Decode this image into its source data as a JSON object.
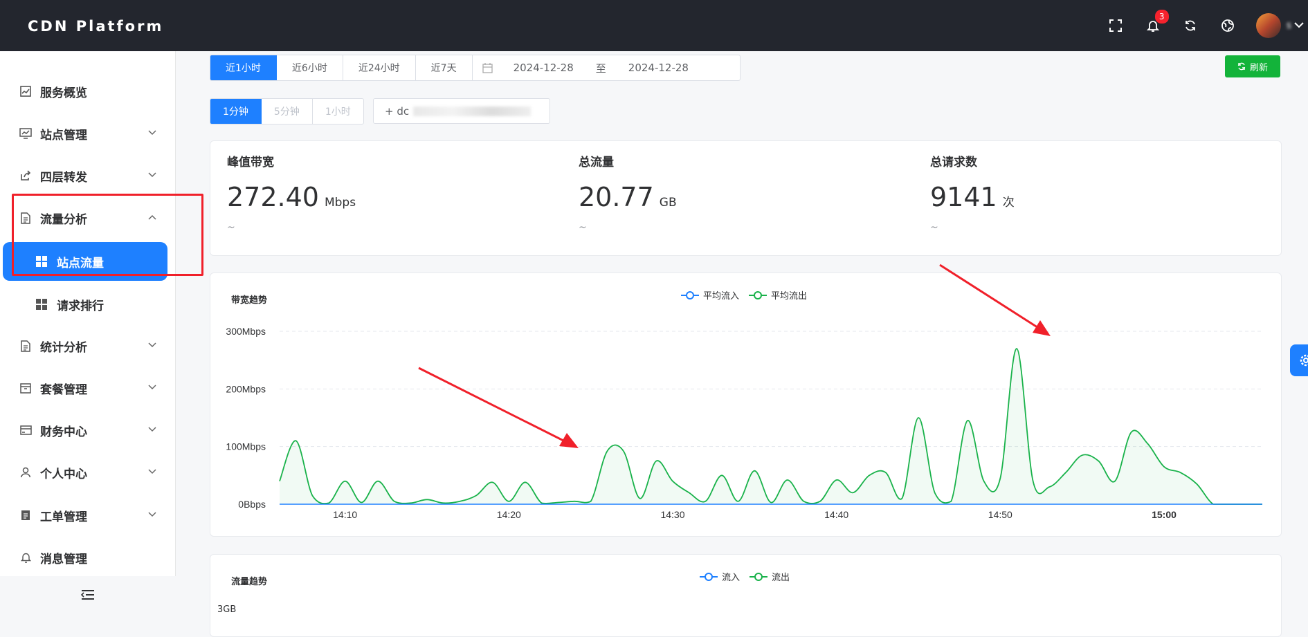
{
  "app": {
    "title": "CDN Platform"
  },
  "topbar": {
    "notification_count": "3",
    "username": "s"
  },
  "sidebar": {
    "items": [
      {
        "label": "服务概览",
        "icon": "chart-icon"
      },
      {
        "label": "站点管理",
        "icon": "monitor-icon"
      },
      {
        "label": "四层转发",
        "icon": "share-icon"
      },
      {
        "label": "流量分析",
        "icon": "document-icon"
      },
      {
        "label": "统计分析",
        "icon": "document-icon"
      },
      {
        "label": "套餐管理",
        "icon": "box-icon"
      },
      {
        "label": "财务中心",
        "icon": "card-icon"
      },
      {
        "label": "个人中心",
        "icon": "user-icon"
      },
      {
        "label": "工单管理",
        "icon": "ticket-icon"
      },
      {
        "label": "消息管理",
        "icon": "bell-icon"
      }
    ],
    "submenu": [
      {
        "label": "站点流量",
        "active": true
      },
      {
        "label": "请求排行",
        "active": false
      }
    ]
  },
  "filters": {
    "time_ranges": [
      "近1小时",
      "近6小时",
      "近24小时",
      "近7天"
    ],
    "date_start": "2024-12-28",
    "date_sep": "至",
    "date_end": "2024-12-28",
    "granularity": [
      "1分钟",
      "5分钟",
      "1小时"
    ],
    "domain_prefix": "+ dc",
    "refresh_label": "刷新"
  },
  "stats": [
    {
      "label": "峰值带宽",
      "value": "272.40",
      "unit": "Mbps",
      "sub": "~"
    },
    {
      "label": "总流量",
      "value": "20.77",
      "unit": "GB",
      "sub": "~"
    },
    {
      "label": "总请求数",
      "value": "9141",
      "unit": "次",
      "sub": "~"
    }
  ],
  "bandwidth_chart": {
    "title": "带宽趋势",
    "legend": [
      "平均流入",
      "平均流出"
    ]
  },
  "traffic_chart": {
    "title": "流量趋势",
    "legend": [
      "流入",
      "流出"
    ],
    "first_tick": "3GB"
  },
  "colors": {
    "primary": "#1e80ff",
    "success": "#13b33a",
    "inflow": "#1e80ff",
    "outflow": "#19b24a"
  },
  "chart_data": {
    "type": "line",
    "title": "带宽趋势",
    "xlabel": "",
    "ylabel": "",
    "y_ticks": [
      "0Bbps",
      "100Mbps",
      "200Mbps",
      "300Mbps"
    ],
    "ylim": [
      0,
      300
    ],
    "x_ticks": [
      "14:10",
      "14:20",
      "14:30",
      "14:40",
      "14:50",
      "15:00"
    ],
    "x": [
      "14:06",
      "14:07",
      "14:08",
      "14:09",
      "14:10",
      "14:11",
      "14:12",
      "14:13",
      "14:14",
      "14:15",
      "14:16",
      "14:17",
      "14:18",
      "14:19",
      "14:20",
      "14:21",
      "14:22",
      "14:23",
      "14:24",
      "14:25",
      "14:26",
      "14:27",
      "14:28",
      "14:29",
      "14:30",
      "14:31",
      "14:32",
      "14:33",
      "14:34",
      "14:35",
      "14:36",
      "14:37",
      "14:38",
      "14:39",
      "14:40",
      "14:41",
      "14:42",
      "14:43",
      "14:44",
      "14:45",
      "14:46",
      "14:47",
      "14:48",
      "14:49",
      "14:50",
      "14:51",
      "14:52",
      "14:53",
      "14:54",
      "14:55",
      "14:56",
      "14:57",
      "14:58",
      "14:59",
      "15:00",
      "15:01",
      "15:02",
      "15:03",
      "15:04",
      "15:05",
      "15:06"
    ],
    "series": [
      {
        "name": "平均流入",
        "values": [
          0,
          0,
          0,
          0,
          0,
          0,
          0,
          0,
          0,
          0,
          0,
          0,
          0,
          0,
          0,
          0,
          0,
          0,
          0,
          0,
          0,
          0,
          0,
          0,
          0,
          0,
          0,
          0,
          0,
          0,
          0,
          0,
          0,
          0,
          0,
          0,
          0,
          0,
          0,
          0,
          0,
          0,
          0,
          0,
          0,
          0,
          0,
          0,
          0,
          0,
          0,
          0,
          0,
          0,
          0,
          0,
          0,
          0,
          0,
          0,
          0
        ]
      },
      {
        "name": "平均流出",
        "values": [
          40,
          110,
          15,
          2,
          40,
          3,
          40,
          5,
          2,
          8,
          2,
          5,
          15,
          38,
          5,
          38,
          2,
          3,
          5,
          5,
          92,
          92,
          10,
          75,
          40,
          20,
          5,
          50,
          5,
          58,
          3,
          42,
          5,
          5,
          42,
          20,
          50,
          55,
          10,
          150,
          20,
          5,
          145,
          40,
          45,
          270,
          40,
          30,
          55,
          85,
          75,
          40,
          125,
          105,
          65,
          55,
          35,
          0,
          0,
          0,
          0
        ]
      }
    ]
  }
}
